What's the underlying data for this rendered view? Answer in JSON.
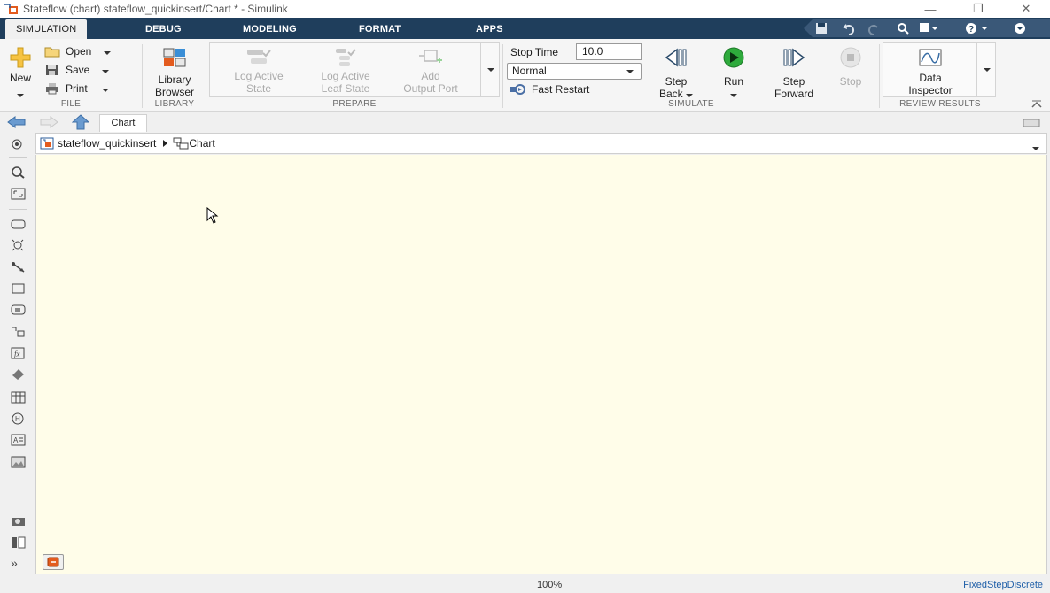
{
  "window": {
    "title": "Stateflow (chart) stateflow_quickinsert/Chart * - Simulink",
    "minimize_glyph": "—",
    "restore_glyph": "❐",
    "close_glyph": "✕"
  },
  "tabs": [
    {
      "label": "SIMULATION",
      "active": true
    },
    {
      "label": "DEBUG"
    },
    {
      "label": "MODELING"
    },
    {
      "label": "FORMAT"
    },
    {
      "label": "APPS"
    }
  ],
  "ribbon": {
    "file": {
      "new_label": "New",
      "open_label": "Open",
      "save_label": "Save",
      "print_label": "Print",
      "group_label": "FILE"
    },
    "library": {
      "browser_label_1": "Library",
      "browser_label_2": "Browser",
      "group_label": "LIBRARY"
    },
    "prepare": {
      "log_active_state_1": "Log Active",
      "log_active_state_2": "State",
      "log_leaf_state_1": "Log Active",
      "log_leaf_state_2": "Leaf State",
      "add_output_port_1": "Add",
      "add_output_port_2": "Output Port",
      "group_label": "PREPARE"
    },
    "simulate": {
      "stop_time_label": "Stop Time",
      "stop_time_value": "10.0",
      "mode_value": "Normal",
      "fast_restart_label": "Fast Restart",
      "step_back_1": "Step",
      "step_back_2": "Back",
      "run_label": "Run",
      "step_forward_1": "Step",
      "step_forward_2": "Forward",
      "stop_label": "Stop",
      "group_label": "SIMULATE"
    },
    "review": {
      "data_inspector_1": "Data",
      "data_inspector_2": "Inspector",
      "group_label": "REVIEW RESULTS"
    }
  },
  "nav": {
    "tab_label": "Chart"
  },
  "breadcrumb": {
    "model": "stateflow_quickinsert",
    "chart": "Chart"
  },
  "status": {
    "zoom": "100%",
    "solver": "FixedStepDiscrete"
  },
  "expand_glyph": "»",
  "colors": {
    "tabbar": "#1f3e5c",
    "canvas": "#fffde9",
    "run_green": "#2eaa3c",
    "status_link": "#1f5fa8"
  }
}
